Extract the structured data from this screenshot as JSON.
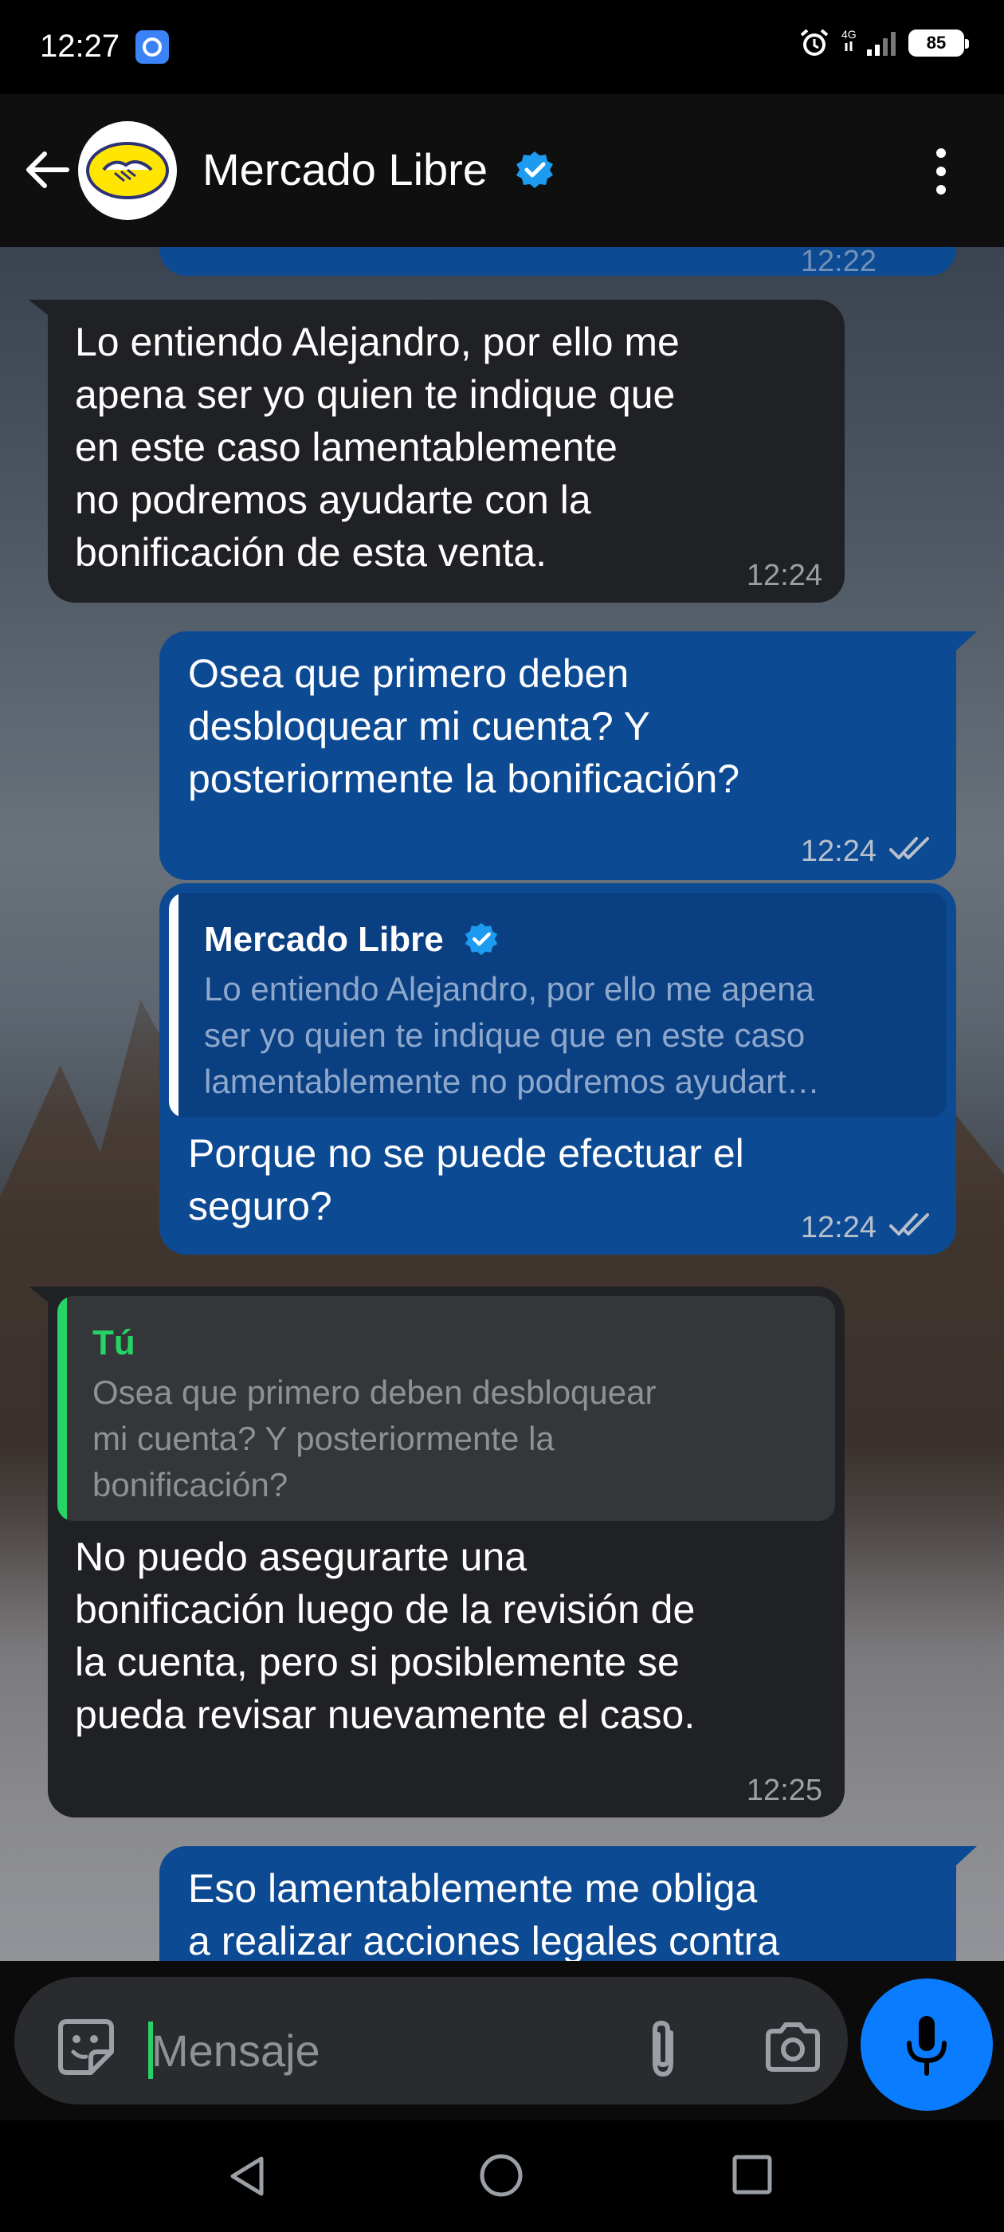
{
  "status_bar": {
    "time": "12:27",
    "network": "4G",
    "battery": "85",
    "icons": [
      "browser-app-icon",
      "alarm-icon",
      "signal-icon",
      "battery-icon"
    ]
  },
  "header": {
    "title": "Mercado Libre",
    "verified": true,
    "icons": [
      "back-arrow-icon",
      "avatar-handshake-logo",
      "verified-badge-icon",
      "more-vert-icon"
    ]
  },
  "messages": [
    {
      "direction": "out",
      "time": "12:22",
      "partial": true
    },
    {
      "direction": "in",
      "text_lines": [
        "Lo entiendo Alejandro, por ello me",
        "apena ser yo quien te indique que",
        "en este caso lamentablemente",
        "no podremos ayudarte con la",
        "bonificación de esta venta."
      ],
      "time": "12:24"
    },
    {
      "direction": "out",
      "text_lines": [
        "Osea que primero deben",
        "desbloquear mi cuenta? Y",
        "posteriormente la bonificación?"
      ],
      "time": "12:24"
    },
    {
      "direction": "out",
      "quote": {
        "name": "Mercado Libre",
        "lines": [
          "Lo entiendo Alejandro, por ello me apena",
          "ser yo quien te indique que en este caso",
          "lamentablemente no podremos ayudart…"
        ]
      },
      "text_lines": [
        "Porque no se puede efectuar el",
        "seguro?"
      ],
      "time": "12:24"
    },
    {
      "direction": "in",
      "quote": {
        "name": "Tú",
        "lines": [
          "Osea que primero deben desbloquear",
          "mi cuenta? Y posteriormente la",
          "bonificación?"
        ]
      },
      "text_lines": [
        "No puedo asegurarte una",
        "bonificación luego de la revisión de",
        "la cuenta, pero si posiblemente se",
        "pueda revisar nuevamente el caso."
      ],
      "time": "12:25"
    },
    {
      "direction": "out",
      "text_lines": [
        "Eso lamentablemente me obliga",
        "a realizar acciones legales contra"
      ],
      "partial": true
    }
  ],
  "input": {
    "placeholder": "Mensaje",
    "icons": [
      "emoji-sticker-icon",
      "attach-paperclip-icon",
      "camera-icon",
      "mic-icon"
    ]
  },
  "colors": {
    "outgoing_bubble": "#0d4a94",
    "incoming_bubble": "#202124",
    "accent_blue": "#0a7cff",
    "quote_green": "#25d366",
    "verified_blue": "#1d9bf0"
  },
  "nav_bar": {
    "icons": [
      "nav-back-icon",
      "nav-home-icon",
      "nav-recents-icon"
    ]
  }
}
